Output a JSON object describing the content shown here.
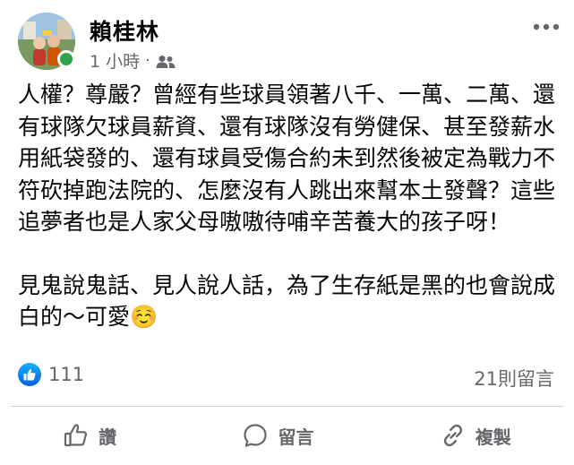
{
  "post": {
    "author": "賴桂林",
    "time": "1 小時",
    "separator": "·",
    "audience_icon": "friends-icon",
    "paragraphs": [
      "人權？尊嚴？曾經有些球員領著八千、一萬、二萬、還有球隊欠球員薪資、還有球隊沒有勞健保、甚至發薪水用紙袋發的、還有球員受傷合約未到然後被定為戰力不符砍掉跑法院的、怎麼沒有人跳出來幫本土發聲？這些追夢者也是人家父母嗷嗷待哺辛苦養大的孩子呀！",
      "見鬼說鬼話、見人說人話，為了生存紙是黑的也會說成白的～可愛☺️"
    ]
  },
  "reactions": {
    "like_count": "111",
    "comments": "21則留言"
  },
  "actions": {
    "like_label": "讚",
    "comment_label": "留言",
    "share_label": "複製"
  },
  "colors": {
    "like_blue": "#1877f2",
    "online_green": "#31a24c",
    "secondary_text": "#65676b"
  }
}
